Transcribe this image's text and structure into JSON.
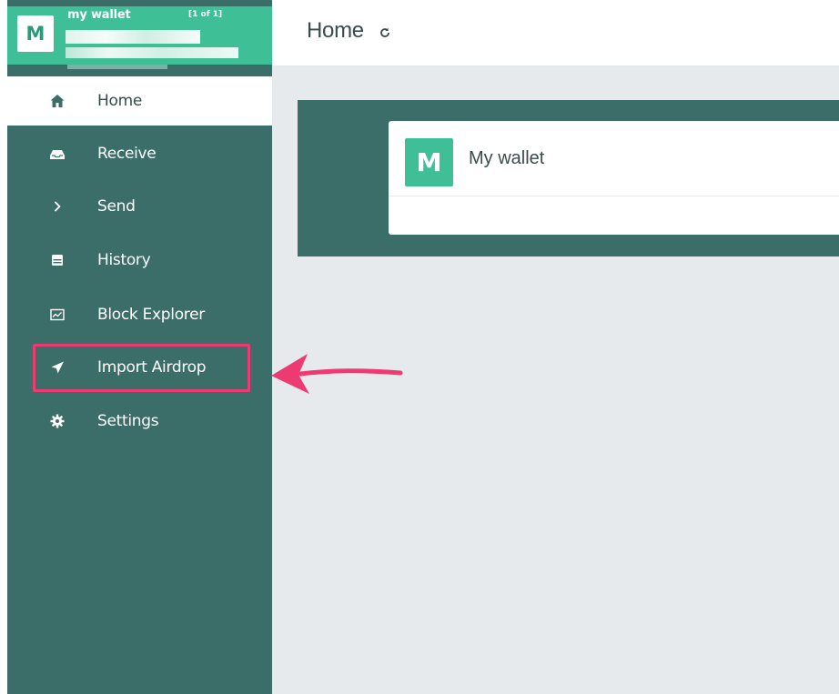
{
  "wallet": {
    "avatar_letter": "M",
    "name": "my wallet",
    "count": "[1 of 1]"
  },
  "sidebar": {
    "items": [
      {
        "label": "Home",
        "icon": "home-icon",
        "active": true
      },
      {
        "label": "Receive",
        "icon": "inbox-icon",
        "active": false
      },
      {
        "label": "Send",
        "icon": "chevron-right-icon",
        "active": false
      },
      {
        "label": "History",
        "icon": "history-icon",
        "active": false
      },
      {
        "label": "Block Explorer",
        "icon": "chart-icon",
        "active": false
      },
      {
        "label": "Import Airdrop",
        "icon": "paper-plane-icon",
        "active": false
      },
      {
        "label": "Settings",
        "icon": "gear-icon",
        "active": false
      }
    ]
  },
  "header": {
    "title": "Home",
    "refresh_icon": "refresh-icon"
  },
  "main": {
    "wallet_card": {
      "avatar_letter": "M",
      "name": "My wallet"
    }
  },
  "colors": {
    "sidebar": "#3b6e69",
    "accent": "#3fbf96",
    "content_bg": "#e6eaed",
    "highlight": "#ee3a73"
  }
}
